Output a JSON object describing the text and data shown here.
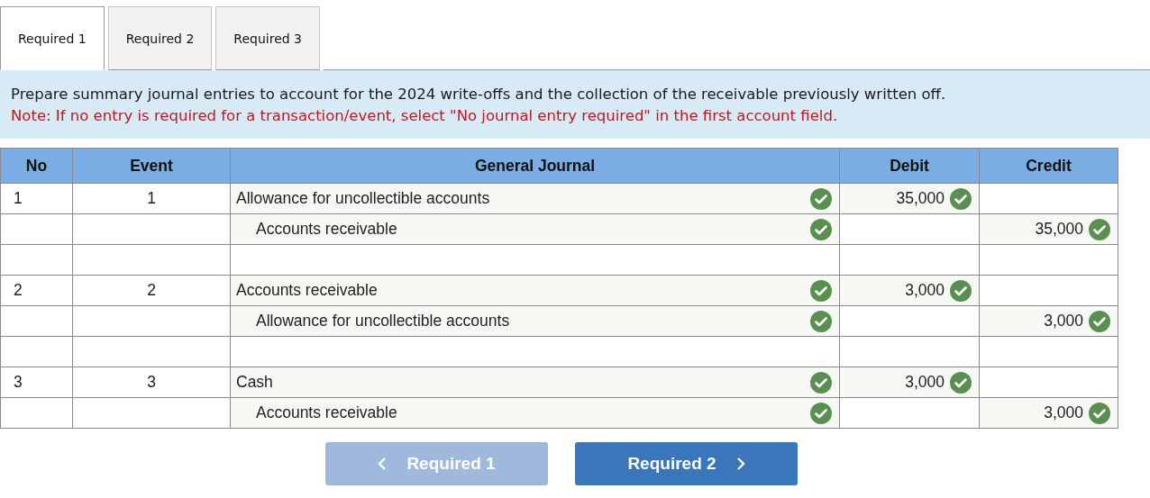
{
  "tabs": [
    {
      "label": "Required 1",
      "selected": true
    },
    {
      "label": "Required 2",
      "selected": false
    },
    {
      "label": "Required 3",
      "selected": false
    }
  ],
  "instructions": {
    "text": "Prepare summary journal entries to account for the 2024 write-offs and the collection of the receivable previously written off.",
    "note": "Note: If no entry is required for a transaction/event, select \"No journal entry required\" in the first account field."
  },
  "table": {
    "columns": [
      "No",
      "Event",
      "General Journal",
      "Debit",
      "Credit"
    ],
    "rows": [
      {
        "kind": "debit",
        "no": "1",
        "event": "1",
        "account": "Allowance for uncollectible accounts",
        "account_correct": true,
        "amount": "35,000",
        "amount_correct": true
      },
      {
        "kind": "credit",
        "account": "Accounts receivable",
        "account_correct": true,
        "amount": "35,000",
        "amount_correct": true
      },
      {
        "kind": "blank"
      },
      {
        "kind": "debit",
        "no": "2",
        "event": "2",
        "account": "Accounts receivable",
        "account_correct": true,
        "amount": "3,000",
        "amount_correct": true
      },
      {
        "kind": "credit",
        "account": "Allowance for uncollectible accounts",
        "account_correct": true,
        "amount": "3,000",
        "amount_correct": true
      },
      {
        "kind": "blank"
      },
      {
        "kind": "debit",
        "no": "3",
        "event": "3",
        "account": "Cash",
        "account_correct": true,
        "amount": "3,000",
        "amount_correct": true
      },
      {
        "kind": "credit",
        "account": "Accounts receivable",
        "account_correct": true,
        "amount": "3,000",
        "amount_correct": true
      }
    ]
  },
  "nav": {
    "previous": {
      "label": "Required 1",
      "disabled": true
    },
    "next": {
      "label": "Required 2",
      "disabled": false
    }
  }
}
